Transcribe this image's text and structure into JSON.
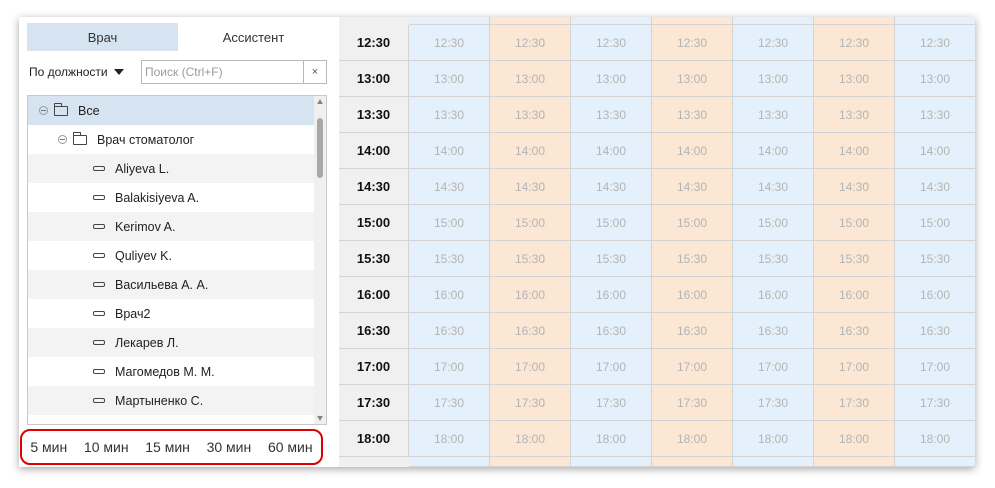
{
  "tabs": [
    "Врач",
    "Ассистент"
  ],
  "filter": {
    "dropdown_label": "По должности",
    "search_placeholder": "Поиск (Ctrl+F)",
    "clear_symbol": "×"
  },
  "tree": {
    "root": "Все",
    "group": "Врач стоматолог",
    "items": [
      "Aliyeva L.",
      "Balakisiyeva A.",
      "Kerimov A.",
      "Quliyev K.",
      "Васильева А. А.",
      "Врач2",
      "Лекарев Л.",
      "Магомедов М. М.",
      "Мартыненко С."
    ]
  },
  "intervals": [
    "5 мин",
    "10 мин",
    "15 мин",
    "30 мин",
    "60 мин"
  ],
  "schedule": {
    "times": [
      "12:30",
      "13:00",
      "13:30",
      "14:00",
      "14:30",
      "15:00",
      "15:30",
      "16:00",
      "16:30",
      "17:00",
      "17:30",
      "18:00"
    ],
    "column_colors": [
      "blue",
      "peach",
      "blue",
      "peach",
      "blue",
      "peach",
      "blue"
    ]
  },
  "colors": {
    "blue_cell": "#e4f0fb",
    "peach_cell": "#fce6d4",
    "selection": "#d6e4f2",
    "highlight_border": "#e00000"
  }
}
